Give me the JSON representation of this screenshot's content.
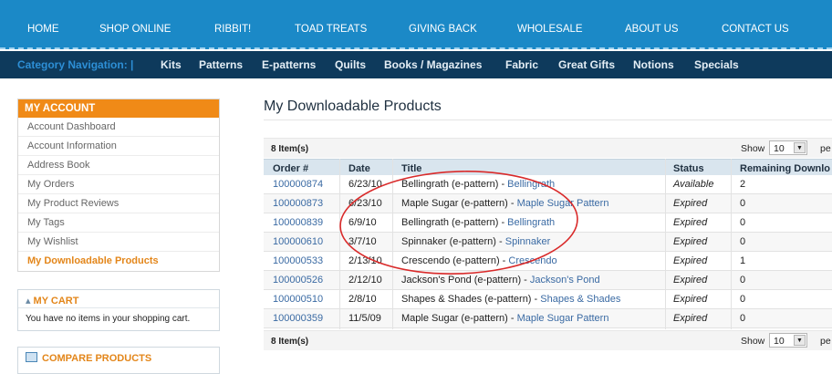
{
  "top_nav": [
    "HOME",
    "SHOP ONLINE",
    "RIBBIT!",
    "TOAD TREATS",
    "GIVING BACK",
    "WHOLESALE",
    "ABOUT US",
    "CONTACT US"
  ],
  "category_nav": {
    "label": "Category Navigation:  |",
    "items": [
      "Kits",
      "Patterns",
      "E-patterns",
      "Quilts",
      "Books / Magazines",
      "Fabric",
      "Great Gifts",
      "Notions",
      "Specials"
    ]
  },
  "account": {
    "heading": "MY ACCOUNT",
    "items": [
      "Account Dashboard",
      "Account Information",
      "Address Book",
      "My Orders",
      "My Product Reviews",
      "My Tags",
      "My Wishlist",
      "My Downloadable Products"
    ],
    "active_index": 7
  },
  "cart": {
    "heading": "MY CART",
    "message": "You have no items in your shopping cart.",
    "icon": "shopping-basket-icon"
  },
  "compare": {
    "heading": "COMPARE PRODUCTS",
    "icon": "compare-list-icon"
  },
  "main": {
    "title": "My Downloadable Products",
    "item_count": "8 Item(s)",
    "show_label": "Show",
    "per_page": "10",
    "per_label": "pe"
  },
  "table": {
    "columns": [
      "Order #",
      "Date",
      "Title",
      "Status",
      "Remaining Downlo"
    ],
    "rows": [
      {
        "order": "100000874",
        "date": "6/23/10",
        "title": "Bellingrath (e-pattern)",
        "link": "Bellingrath",
        "status": "Available",
        "remaining": "2"
      },
      {
        "order": "100000873",
        "date": "6/23/10",
        "title": "Maple Sugar (e-pattern)",
        "link": "Maple Sugar Pattern",
        "status": "Expired",
        "remaining": "0"
      },
      {
        "order": "100000839",
        "date": "6/9/10",
        "title": "Bellingrath (e-pattern)",
        "link": "Bellingrath",
        "status": "Expired",
        "remaining": "0"
      },
      {
        "order": "100000610",
        "date": "3/7/10",
        "title": "Spinnaker (e-pattern)",
        "link": "Spinnaker",
        "status": "Expired",
        "remaining": "0"
      },
      {
        "order": "100000533",
        "date": "2/13/10",
        "title": "Crescendo (e-pattern)",
        "link": "Crescendo",
        "status": "Expired",
        "remaining": "1"
      },
      {
        "order": "100000526",
        "date": "2/12/10",
        "title": "Jackson's Pond (e-pattern)",
        "link": "Jackson's Pond",
        "status": "Expired",
        "remaining": "0"
      },
      {
        "order": "100000510",
        "date": "2/8/10",
        "title": "Shapes & Shades (e-pattern)",
        "link": "Shapes & Shades",
        "status": "Expired",
        "remaining": "0"
      },
      {
        "order": "100000359",
        "date": "11/5/09",
        "title": "Maple Sugar (e-pattern)",
        "link": "Maple Sugar Pattern",
        "status": "Expired",
        "remaining": "0"
      }
    ]
  },
  "colors": {
    "top_nav": "#1b89c7",
    "category_nav": "#0e3a5c",
    "accent_orange": "#f08a17",
    "link_blue": "#3a6aa3",
    "annotation_red": "#d92a2a"
  }
}
